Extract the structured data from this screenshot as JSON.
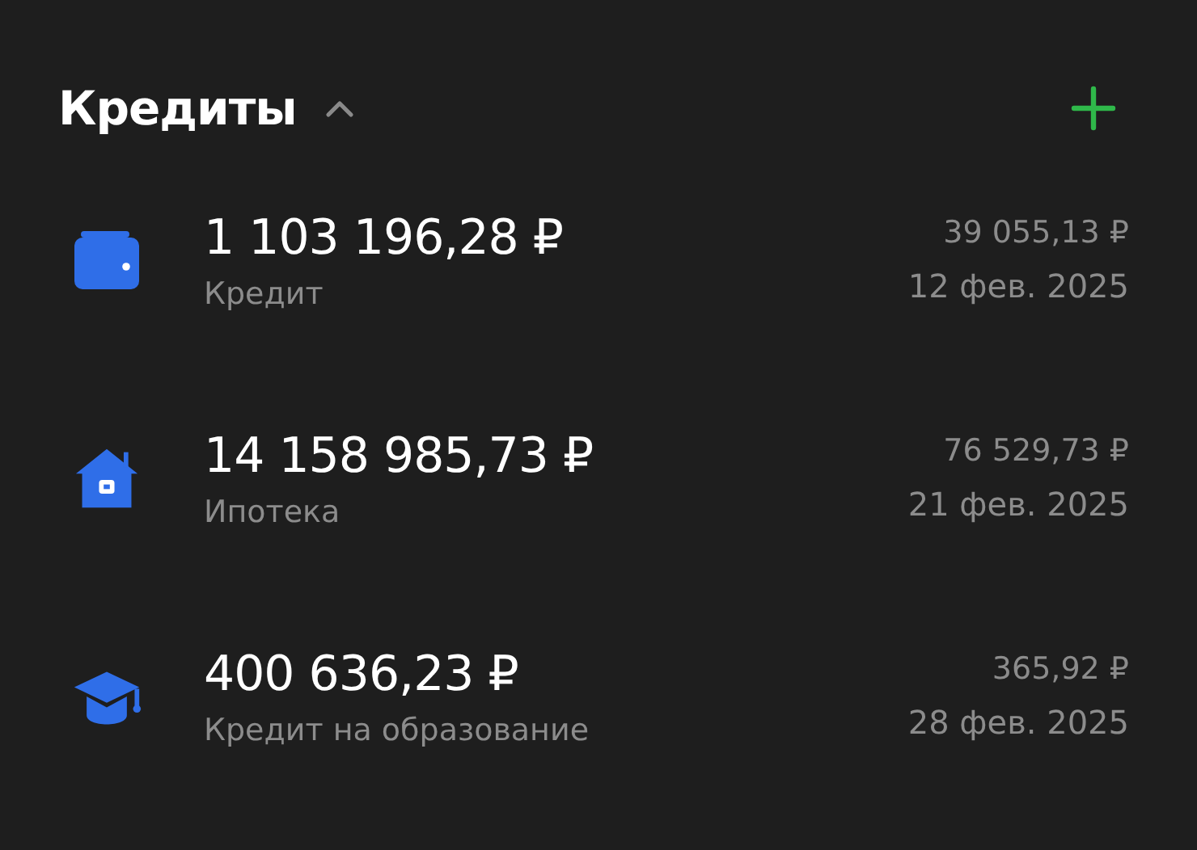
{
  "section": {
    "title": "Кредиты",
    "expanded": true
  },
  "loans": [
    {
      "kind": "wallet",
      "amount": "1 103 196,28 ₽",
      "name": "Кредит",
      "payment": "39 055,13 ₽",
      "date": "12 фев. 2025"
    },
    {
      "kind": "house",
      "amount": "14 158 985,73 ₽",
      "name": "Ипотека",
      "payment": "76 529,73 ₽",
      "date": "21 фев. 2025"
    },
    {
      "kind": "cap",
      "amount": "400 636,23 ₽",
      "name": "Кредит на образование",
      "payment": "365,92 ₽",
      "date": "28 фев. 2025"
    }
  ]
}
